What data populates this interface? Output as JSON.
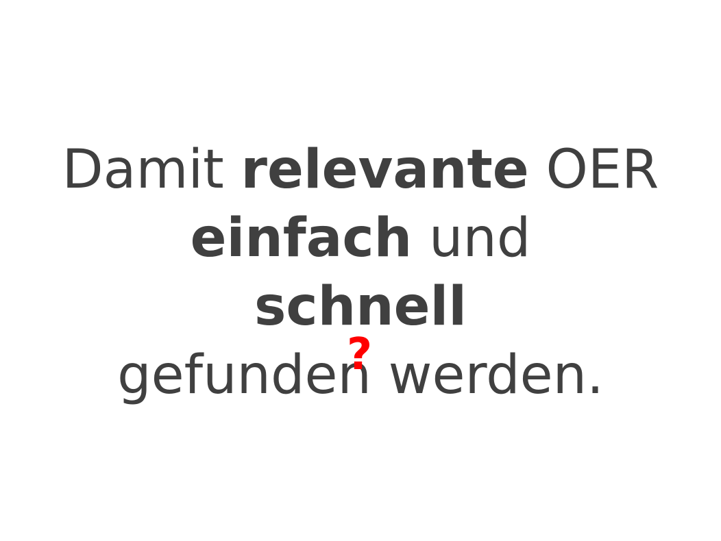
{
  "slide": {
    "line1": {
      "part1": "Damit ",
      "part2": "relevante",
      "part3": " OER"
    },
    "line2": {
      "part1": "einfach",
      "part2": " und"
    },
    "line3": {
      "part1": "schnell"
    },
    "line4": {
      "part1": "gefunden werden."
    },
    "annotation": {
      "mark": "?",
      "color": "#ff0000"
    },
    "text_color": "#404040"
  }
}
